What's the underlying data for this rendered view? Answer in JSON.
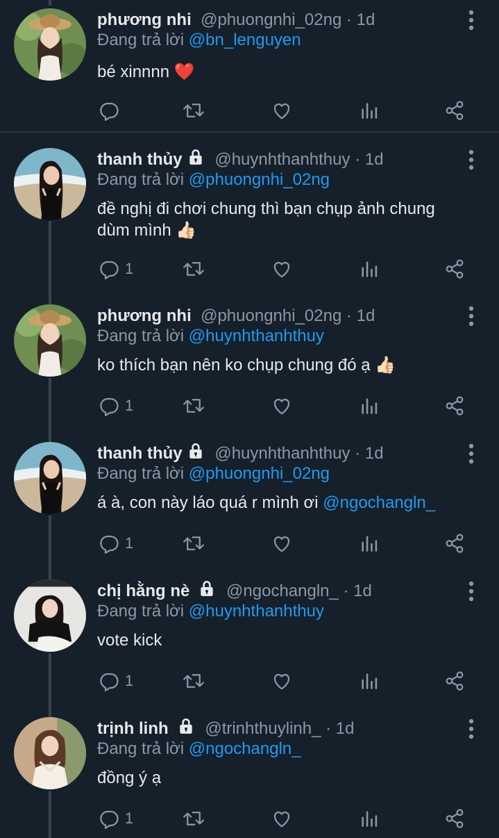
{
  "colors": {
    "background": "#15202b",
    "text": "#e7e9ea",
    "muted": "#8b98a5",
    "accent": "#1d9bf0"
  },
  "reply_prefix": "Đang trả lời",
  "tweets": [
    {
      "name": "phương nhi",
      "locked": false,
      "handle": "@phuongnhi_02ng",
      "time": "· 1d",
      "reply_to": "@bn_lenguyen",
      "text": "bé xinnnn",
      "emoji": "❤️",
      "reply_count": ""
    },
    {
      "name": "thanh thủy",
      "locked": true,
      "handle": "@huynhthanhthuy",
      "time": "· 1d",
      "reply_to": "@phuongnhi_02ng",
      "text": "đề nghị đi chơi chung thì bạn chụp ảnh chung dùm mình",
      "emoji": "👍🏻",
      "reply_count": "1"
    },
    {
      "name": "phương nhi",
      "locked": false,
      "handle": "@phuongnhi_02ng",
      "time": "· 1d",
      "reply_to": "@huynhthanhthuy",
      "text": "ko thích bạn nên ko chụp chung đó ạ",
      "emoji": "👍🏻",
      "reply_count": "1"
    },
    {
      "name": "thanh thủy",
      "locked": true,
      "handle": "@huynhthanhthuy",
      "time": "· 1d",
      "reply_to": "@phuongnhi_02ng",
      "text": "á à, con này láo quá r mình ơi",
      "text_mention": "@ngochangln_",
      "emoji": "",
      "reply_count": "1"
    },
    {
      "name": "chị hằng nè",
      "locked": true,
      "handle": "@ngochangln_",
      "time": "· 1d",
      "reply_to": "@huynhthanhthuy",
      "text": "vote kick",
      "emoji": "",
      "reply_count": "1"
    },
    {
      "name": "trịnh linh",
      "locked": true,
      "handle": "@trinhthuylinh_",
      "time": "· 1d",
      "reply_to": "@ngochangln_",
      "text": "đồng ý ạ",
      "emoji": "",
      "reply_count": "1"
    }
  ]
}
